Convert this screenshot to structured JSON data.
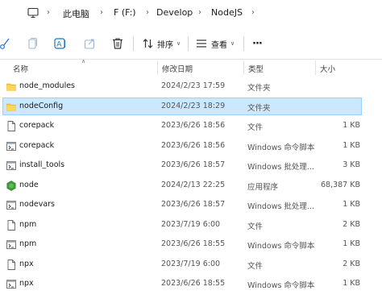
{
  "breadcrumb": {
    "items": [
      "此电脑",
      "F (F:)",
      "Develop",
      "NodeJS"
    ]
  },
  "toolbar": {
    "sort_label": "排序",
    "view_label": "查看",
    "more_label": "···"
  },
  "columns": {
    "name": "名称",
    "date": "修改日期",
    "type": "类型",
    "size": "大小"
  },
  "files": [
    {
      "name": "node_modules",
      "date": "2024/2/23 17:59",
      "type": "文件夹",
      "size": "",
      "icon": "folder-icon",
      "selected": false
    },
    {
      "name": "nodeConfig",
      "date": "2024/2/23 18:29",
      "type": "文件夹",
      "size": "",
      "icon": "folder-icon",
      "selected": true
    },
    {
      "name": "corepack",
      "date": "2023/6/26 18:56",
      "type": "文件",
      "size": "1 KB",
      "icon": "file-icon",
      "selected": false
    },
    {
      "name": "corepack",
      "date": "2023/6/26 18:56",
      "type": "Windows 命令脚本",
      "size": "1 KB",
      "icon": "script-icon",
      "selected": false
    },
    {
      "name": "install_tools",
      "date": "2023/6/26 18:57",
      "type": "Windows 批处理...",
      "size": "3 KB",
      "icon": "script-icon",
      "selected": false
    },
    {
      "name": "node",
      "date": "2024/2/13 22:25",
      "type": "应用程序",
      "size": "68,387 KB",
      "icon": "node-app-icon",
      "selected": false
    },
    {
      "name": "nodevars",
      "date": "2023/6/26 18:57",
      "type": "Windows 批处理...",
      "size": "1 KB",
      "icon": "script-icon",
      "selected": false
    },
    {
      "name": "npm",
      "date": "2023/7/19 6:00",
      "type": "文件",
      "size": "2 KB",
      "icon": "file-icon",
      "selected": false
    },
    {
      "name": "npm",
      "date": "2023/6/26 18:55",
      "type": "Windows 命令脚本",
      "size": "1 KB",
      "icon": "script-icon",
      "selected": false
    },
    {
      "name": "npx",
      "date": "2023/7/19 6:00",
      "type": "文件",
      "size": "2 KB",
      "icon": "file-icon",
      "selected": false
    },
    {
      "name": "npx",
      "date": "2023/6/26 18:55",
      "type": "Windows 命令脚本",
      "size": "1 KB",
      "icon": "script-icon",
      "selected": false
    }
  ],
  "colors": {
    "selection": "#cce8ff",
    "selection_border": "#99d1ff",
    "folder": "#f6c443",
    "node_green": "#3c9b39"
  }
}
